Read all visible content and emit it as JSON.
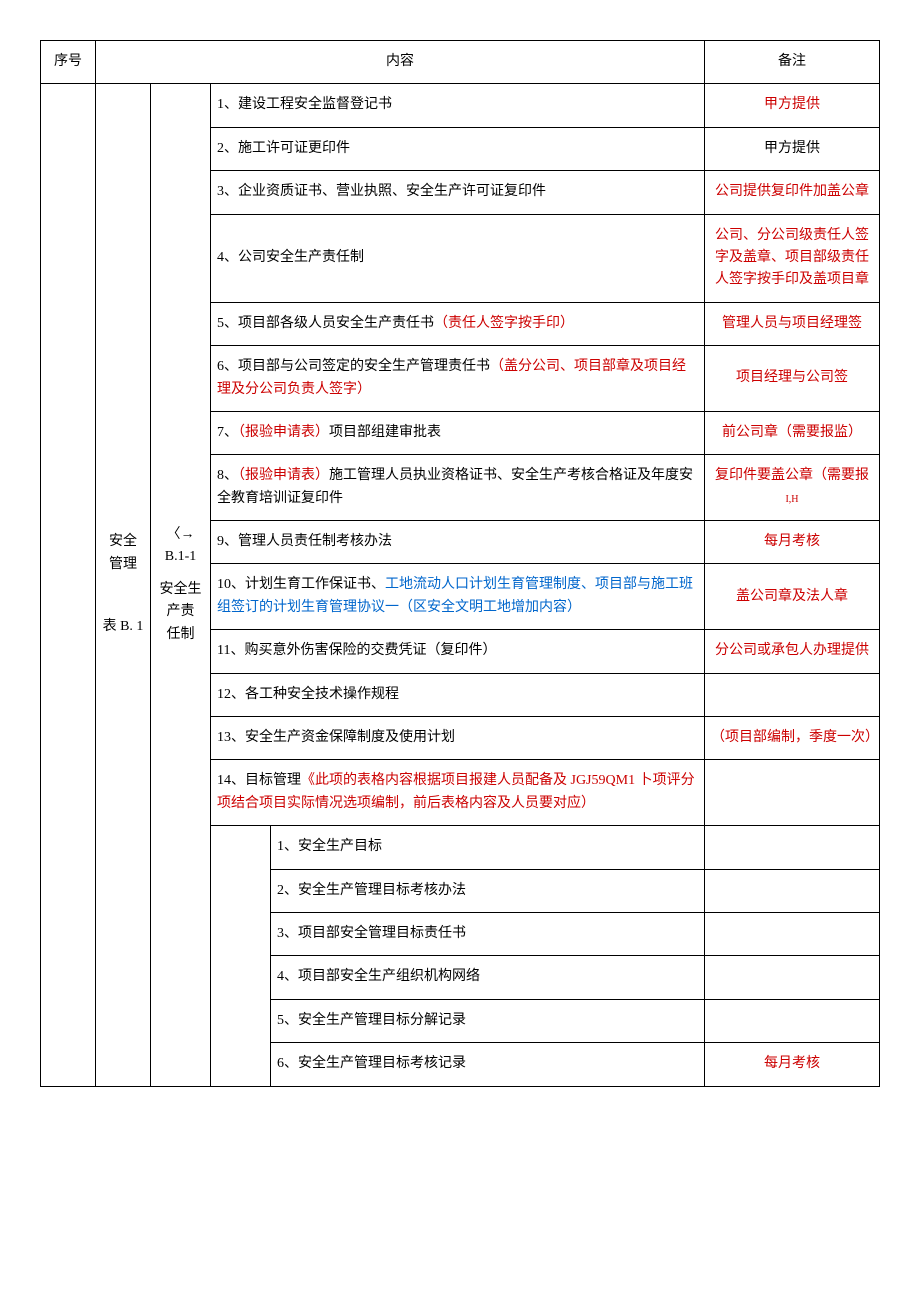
{
  "header": {
    "seq": "序号",
    "content": "内容",
    "remark": "备注"
  },
  "group": {
    "category_line1": "安全",
    "category_line2": "管理",
    "category_line3": "表 B. 1",
    "subcat_arrow": "〈→",
    "subcat_code": "B.1-1",
    "subcat_name1": "安全生产责",
    "subcat_name2": "任制"
  },
  "rows": [
    {
      "text": "1、建设工程安全监督登记书",
      "remark": "甲方提供",
      "remark_red": true
    },
    {
      "text": "2、施工许可证更印件",
      "remark": "甲方提供",
      "remark_red": false
    },
    {
      "text": "3、企业资质证书、营业执照、安全生产许可证复印件",
      "remark": "公司提供复印件加盖公章",
      "remark_red": true
    },
    {
      "text": "4、公司安全生产责任制",
      "remark": "公司、分公司级责任人签字及盖章、项目部级责任人签字按手印及盖项目章",
      "remark_red": true
    },
    {
      "text_pre": "5、项目部各级人员安全生产责任书",
      "text_red": "（责任人签字按手印）",
      "remark": "管理人员与项目经理签",
      "remark_red": true
    },
    {
      "text_pre": "6、项目部与公司签定的安全生产管理责任书",
      "text_red": "（盖分公司、项目部章及项目经理及分公司负责人签字）",
      "remark": "项目经理与公司签",
      "remark_red": true
    },
    {
      "text_pre": "7、",
      "text_red": "（报验申请表）",
      "text_post": "项目部组建审批表",
      "remark": "前公司章（需要报监）",
      "remark_red": true
    },
    {
      "text_pre": "8、",
      "text_red": "（报验申请表）",
      "text_post": "施工管理人员执业资格证书、安全生产考核合格证及年度安全教育培训证复印件",
      "remark_pre": "复印件要盖公章（需要报",
      "remark_suffix": "I,H",
      "remark_red": true
    },
    {
      "text": "9、管理人员责任制考核办法",
      "remark": "每月考核",
      "remark_red": true
    },
    {
      "text_pre": "10、计划生育工作保证书、",
      "text_blue": "工地流动人口计划生育管理制度、项目部与施工班组签订的计划生育管理协议一（区安全文明工地增加内容）",
      "remark": "盖公司章及法人章",
      "remark_red": true
    },
    {
      "text": "11、购买意外伤害保险的交费凭证（复印件）",
      "remark": "分公司或承包人办理提供",
      "remark_red": true
    },
    {
      "text": "12、各工种安全技术操作规程",
      "remark": "",
      "remark_red": false
    },
    {
      "text": "13、安全生产资金保障制度及使用计划",
      "remark": "（项目部编制，季度一次）",
      "remark_red": true
    },
    {
      "text_pre": "14、目标管理",
      "text_red": "《此项的表格内容根据项目报建人员配备及 JGJ59QM1 卜项评分项结合项目实际情况选项编制，前后表格内容及人员要对应）",
      "remark": "",
      "remark_red": false
    }
  ],
  "subrows": [
    {
      "text": "1、安全生产目标",
      "remark": ""
    },
    {
      "text": "2、安全生产管理目标考核办法",
      "remark": ""
    },
    {
      "text": "3、项目部安全管理目标责任书",
      "remark": ""
    },
    {
      "text": "4、项目部安全生产组织机构网络",
      "remark": ""
    },
    {
      "text": "5、安全生产管理目标分解记录",
      "remark": ""
    },
    {
      "text": "6、安全生产管理目标考核记录",
      "remark": "每月考核",
      "remark_red": true
    }
  ]
}
